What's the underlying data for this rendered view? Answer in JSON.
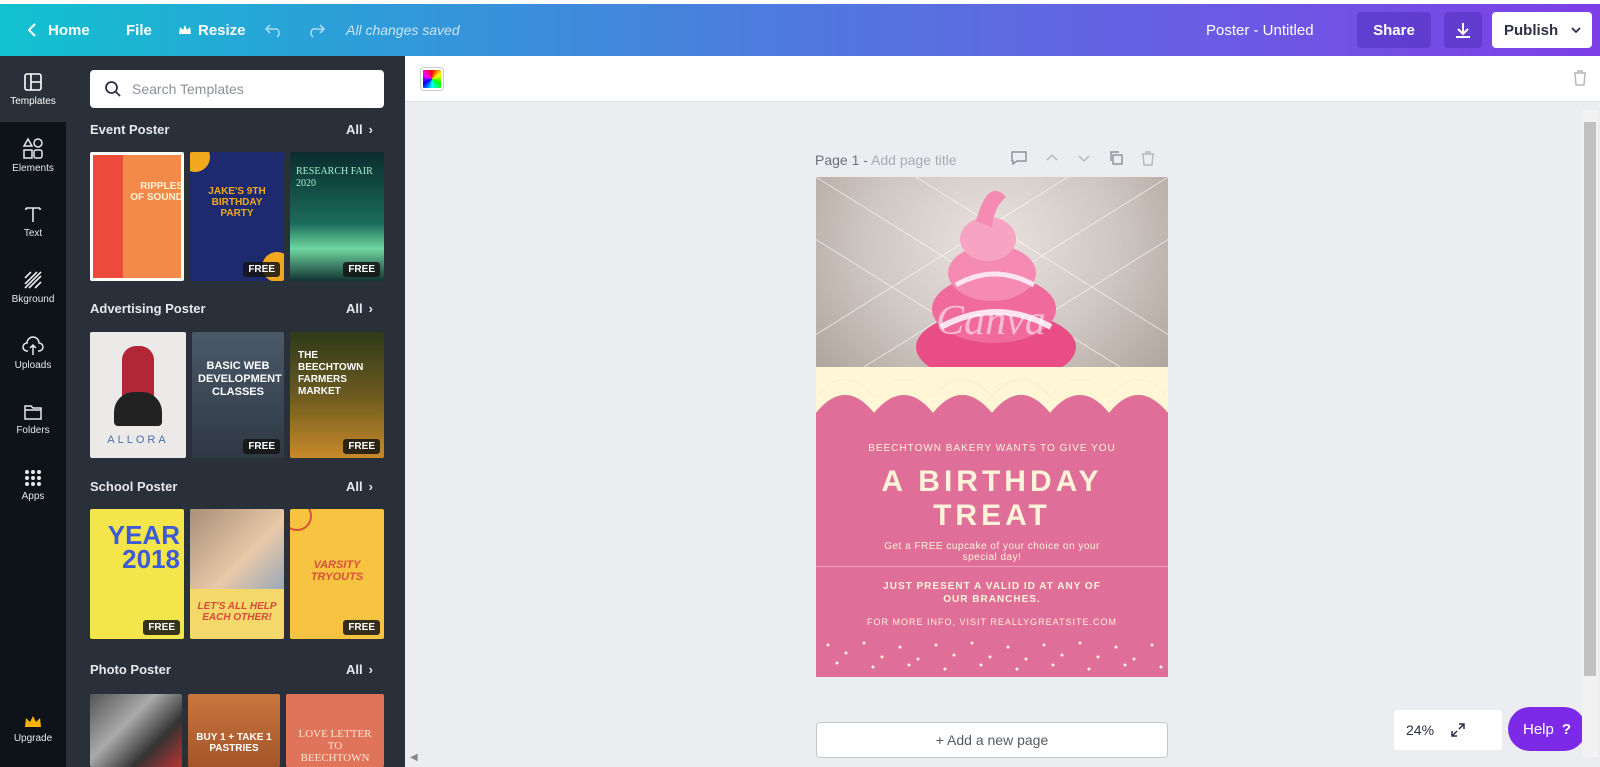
{
  "topbar": {
    "home": "Home",
    "file": "File",
    "resize": "Resize",
    "save_status": "All changes saved",
    "doc_title": "Poster - Untitled",
    "share": "Share",
    "publish": "Publish"
  },
  "rail": {
    "items": [
      {
        "label": "Templates",
        "icon": "templates-icon"
      },
      {
        "label": "Elements",
        "icon": "elements-icon"
      },
      {
        "label": "Text",
        "icon": "text-icon"
      },
      {
        "label": "Bkground",
        "icon": "background-icon"
      },
      {
        "label": "Uploads",
        "icon": "uploads-icon"
      },
      {
        "label": "Folders",
        "icon": "folders-icon"
      },
      {
        "label": "Apps",
        "icon": "apps-icon"
      }
    ],
    "upgrade": "Upgrade"
  },
  "panel": {
    "search_placeholder": "Search Templates",
    "all_label": "All",
    "free_label": "FREE",
    "sections": [
      {
        "title": "Event Poster",
        "thumbs": [
          "RIPPLES OF SOUND",
          "JAKE'S 9TH BIRTHDAY PARTY",
          "RESEARCH FAIR 2020"
        ]
      },
      {
        "title": "Advertising Poster",
        "thumbs": [
          "ALLORA",
          "BASIC WEB DEVELOPMENT CLASSES",
          "THE BEECHTOWN FARMERS MARKET"
        ]
      },
      {
        "title": "School Poster",
        "thumbs": [
          "YEAR 2018",
          "LET'S ALL HELP EACH OTHER!",
          "VARSITY TRYOUTS"
        ]
      },
      {
        "title": "Photo Poster",
        "thumbs": [
          "",
          "BUY 1 + TAKE 1 PASTRIES",
          "LOVE LETTER TO BEECHTOWN"
        ]
      }
    ]
  },
  "canvas": {
    "page_label": "Page 1 - ",
    "page_title_hint": "Add page title",
    "add_page": "+ Add a new page",
    "zoom": "24%",
    "help": "Help",
    "help_icon": "?"
  },
  "poster": {
    "watermark": "Canva",
    "line1": "BEECHTOWN BAKERY WANTS TO GIVE YOU",
    "headline_1": "A BIRTHDAY",
    "headline_2": "TREAT",
    "line3": "Get a FREE cupcake of your choice on your special day!",
    "line4": "JUST PRESENT A VALID ID AT ANY OF OUR BRANCHES.",
    "line5": "FOR MORE INFO, VISIT REALLYGREATSITE.COM",
    "colors": {
      "pink": "#df6f98",
      "cream": "#fff3da"
    }
  }
}
